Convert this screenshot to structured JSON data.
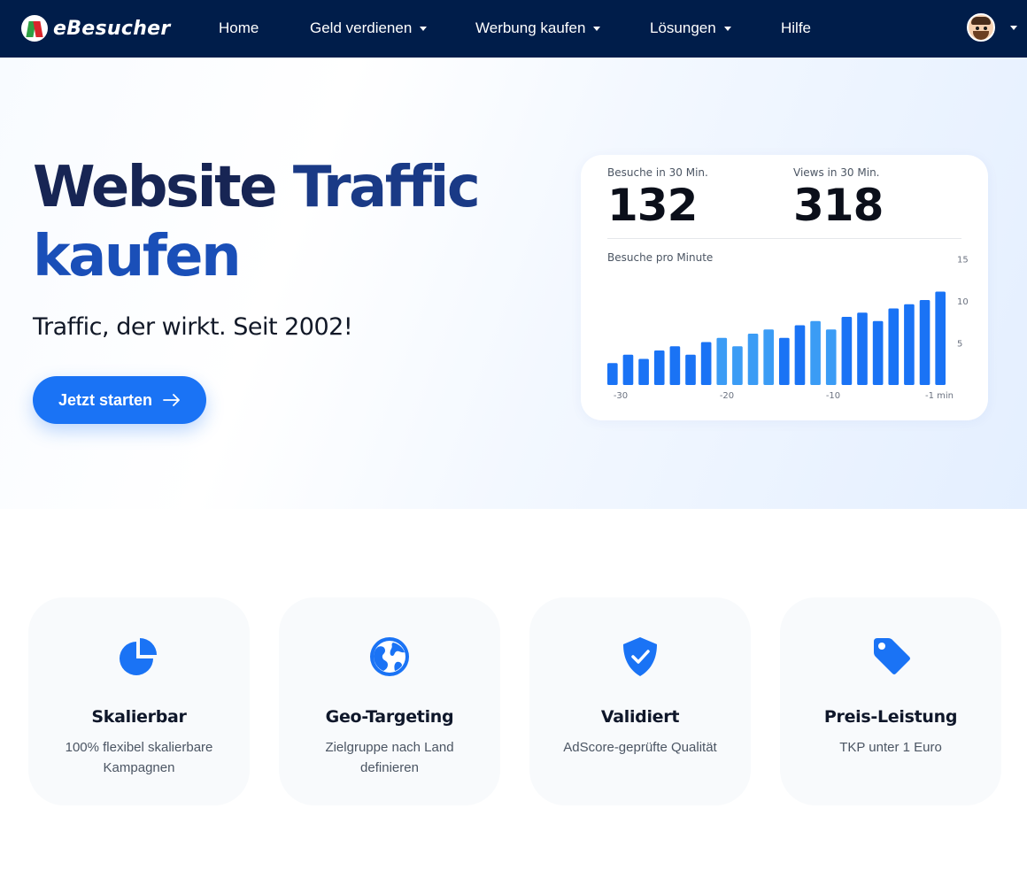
{
  "nav": {
    "brand": "eBesucher",
    "items": [
      {
        "label": "Home",
        "has_dropdown": false
      },
      {
        "label": "Geld verdienen",
        "has_dropdown": true
      },
      {
        "label": "Werbung kaufen",
        "has_dropdown": true
      },
      {
        "label": "Lösungen",
        "has_dropdown": true
      },
      {
        "label": "Hilfe",
        "has_dropdown": false
      }
    ]
  },
  "hero": {
    "title_part1": "Website",
    "title_part2": "Traffic",
    "title_part3": "kaufen",
    "subtitle": "Traffic, der wirkt. Seit 2002!",
    "cta_label": "Jetzt starten"
  },
  "stats": {
    "visits_label": "Besuche in 30 Min.",
    "visits_value": "132",
    "views_label": "Views in 30 Min.",
    "views_value": "318",
    "chart_label": "Besuche pro Minute"
  },
  "chart_data": {
    "type": "bar",
    "title": "Besuche pro Minute",
    "xlabel": "",
    "ylabel": "",
    "x_tick_labels": [
      "-30",
      "-20",
      "-10",
      "-1 min"
    ],
    "y_tick_labels": [
      "15",
      "10",
      "5"
    ],
    "ylim": [
      0,
      16
    ],
    "values": [
      2.6,
      3.6,
      3.1,
      4.1,
      4.6,
      3.6,
      5.1,
      5.6,
      4.6,
      6.1,
      6.6,
      5.6,
      7.1,
      7.6,
      6.6,
      8.1,
      8.6,
      7.6,
      9.1,
      9.6,
      10.1,
      11.1
    ],
    "colors": {
      "primary": "#1a73f5",
      "accent": "#3b9cf5"
    }
  },
  "features": [
    {
      "title": "Skalierbar",
      "desc": "100% flexibel skalierbare Kampagnen",
      "icon": "pie-chart-icon"
    },
    {
      "title": "Geo-Targeting",
      "desc": "Zielgruppe nach Land definieren",
      "icon": "globe-icon"
    },
    {
      "title": "Validiert",
      "desc": "AdScore-geprüfte Qualität",
      "icon": "shield-check-icon"
    },
    {
      "title": "Preis-Leistung",
      "desc": "TKP unter 1 Euro",
      "icon": "price-tag-icon"
    }
  ],
  "colors": {
    "navbar": "#001d4a",
    "primary": "#1a73f5",
    "title_dark": "#172554",
    "title_blue": "#1a4fb8"
  }
}
